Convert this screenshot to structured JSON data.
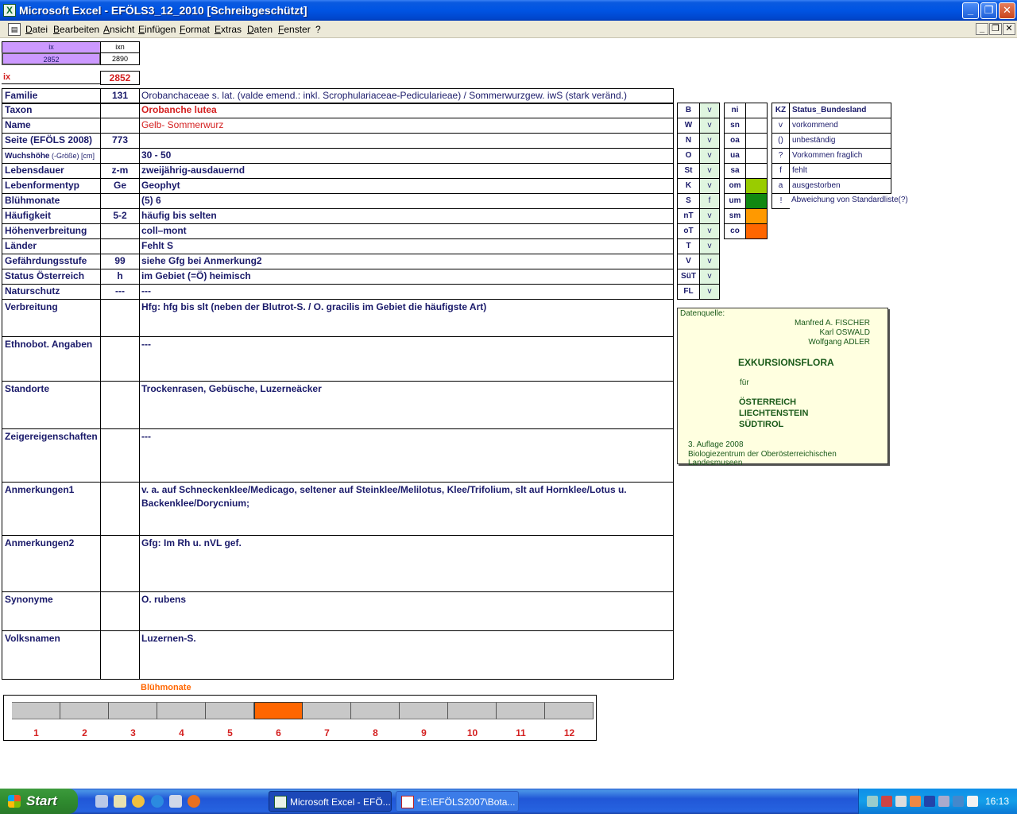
{
  "window": {
    "title": "Microsoft Excel - EFÖLS3_12_2010  [Schreibgeschützt]",
    "app_icon": "excel-icon"
  },
  "menu": {
    "items": [
      "Datei",
      "Bearbeiten",
      "Ansicht",
      "Einfügen",
      "Format",
      "Extras",
      "Daten",
      "Fenster",
      "?"
    ]
  },
  "header_cells": {
    "ix_label": "ix",
    "ixn_label": "ixn",
    "ix_value": "2852",
    "ixn_value": "2890",
    "ix_big_label": "ix",
    "ix_big_value": "2852"
  },
  "rows": [
    {
      "label": "Familie",
      "code": "131",
      "value": "Orobanchaceae s. lat. (valde emend.: inkl. Scrophulariaceae-Pedicularieae)  /  Sommerwurzgew. iwS (stark veränd.)"
    },
    {
      "label": "Taxon",
      "code": "",
      "value": "Orobanche lutea"
    },
    {
      "label": "Name",
      "code": "",
      "value": "Gelb- Sommerwurz"
    },
    {
      "label": "Seite (EFÖLS 2008)",
      "code": "773",
      "value": ""
    },
    {
      "label": "Wuchshöhe",
      "label_suffix": " (-Größe) [cm]",
      "code": "",
      "value": " 30 - 50"
    },
    {
      "label": "Lebensdauer",
      "code": "z-m",
      "value": "zweijährig-ausdauernd"
    },
    {
      "label": "Lebenformentyp",
      "code": "Ge",
      "value": "Geophyt"
    },
    {
      "label": "Blühmonate",
      "code": "",
      "value": "(5) 6"
    },
    {
      "label": "Häufigkeit",
      "code": "5-2",
      "value": "häufig bis selten"
    },
    {
      "label": "Höhenverbreitung",
      "code": "",
      "value": "coll–mont"
    },
    {
      "label": "Länder",
      "code": "",
      "value": "Fehlt S"
    },
    {
      "label": "Gefährdungsstufe",
      "code": "99",
      "value": "siehe Gfg bei Anmerkung2"
    },
    {
      "label": "Status Österreich",
      "code": "h",
      "value": "im Gebiet (=Ö) heimisch"
    },
    {
      "label": "Naturschutz",
      "code": "---",
      "value": " ---"
    }
  ],
  "big_rows": [
    {
      "label": "Verbreitung",
      "value": "Hfg: hfg bis slt (neben der Blutrot-S. / O. gracilis im Gebiet die häufigste Art)"
    },
    {
      "label": "Ethnobot. Angaben",
      "value": "---"
    },
    {
      "label": "Standorte",
      "value": "Trockenrasen, Gebüsche, Luzerneäcker"
    },
    {
      "label": "Zeigereigenschaften",
      "value": "---"
    },
    {
      "label": "Anmerkungen1",
      "value": "v. a. auf Schneckenklee/Medicago, seltener auf Steinklee/Melilotus, Klee/Trifolium, slt auf Hornklee/Lotus u. Backenklee/Dorycnium;"
    },
    {
      "label": "Anmerkungen2",
      "value": "Gfg: Im Rh u. nVL gef."
    },
    {
      "label": "Synonyme",
      "value": "O. rubens"
    },
    {
      "label": "Volksnamen",
      "value": "Luzernen-S."
    }
  ],
  "states": [
    {
      "code": "B",
      "status": "v"
    },
    {
      "code": "W",
      "status": "v"
    },
    {
      "code": "N",
      "status": "v"
    },
    {
      "code": "O",
      "status": "v"
    },
    {
      "code": "St",
      "status": "v"
    },
    {
      "code": "K",
      "status": "v"
    },
    {
      "code": "S",
      "status": "f"
    },
    {
      "code": "nT",
      "status": "v"
    },
    {
      "code": "oT",
      "status": "v"
    },
    {
      "code": "T",
      "status": "v"
    },
    {
      "code": "V",
      "status": "v"
    },
    {
      "code": "SüT",
      "status": "v"
    },
    {
      "code": "FL",
      "status": "v"
    }
  ],
  "height_zones": [
    {
      "code": "ni",
      "color": ""
    },
    {
      "code": "sn",
      "color": ""
    },
    {
      "code": "oa",
      "color": ""
    },
    {
      "code": "ua",
      "color": ""
    },
    {
      "code": "sa",
      "color": ""
    },
    {
      "code": "om",
      "color": "#99cc00"
    },
    {
      "code": "um",
      "color": "#118811"
    },
    {
      "code": "sm",
      "color": "#ff9900"
    },
    {
      "code": "co",
      "color": "#ff6600"
    }
  ],
  "legend": {
    "kz_header": "KZ",
    "status_header": "Status_Bundesland",
    "entries": [
      {
        "kz": "v",
        "text": "vorkommend"
      },
      {
        "kz": "()",
        "text": "unbeständig"
      },
      {
        "kz": "?",
        "text": "Vorkommen fraglich"
      },
      {
        "kz": "f",
        "text": "fehlt"
      },
      {
        "kz": "a",
        "text": "ausgestorben"
      },
      {
        "kz": "!",
        "text": "Abweichung von Standardliste(?)"
      }
    ]
  },
  "book": {
    "source_label": "Datenquelle:",
    "author1": "Manfred A. FISCHER",
    "author2": "Karl OSWALD",
    "author3": "Wolfgang ADLER",
    "title": "EXKURSIONSFLORA",
    "for": "für",
    "country1": "ÖSTERREICH",
    "country2": "LIECHTENSTEIN",
    "country3": "SÜDTIROL",
    "edition": "3. Auflage 2008",
    "publisher": "Biologiezentrum der Oberösterreichischen Landesmuseen"
  },
  "flowering": {
    "title": "Blühmonate",
    "months": [
      "1",
      "2",
      "3",
      "4",
      "5",
      "6",
      "7",
      "8",
      "9",
      "10",
      "11",
      "12"
    ],
    "active": [
      6
    ],
    "active_color": "#ff6600",
    "inactive_color": "#c8c8c8"
  },
  "taskbar": {
    "start_label": "Start",
    "tasks": [
      {
        "label": "Microsoft Excel - EFÖ...",
        "icon": "excel-icon"
      },
      {
        "label": "*E:\\EFÖLS2007\\Bota...",
        "icon": "document-icon"
      }
    ],
    "clock": "16:13"
  }
}
